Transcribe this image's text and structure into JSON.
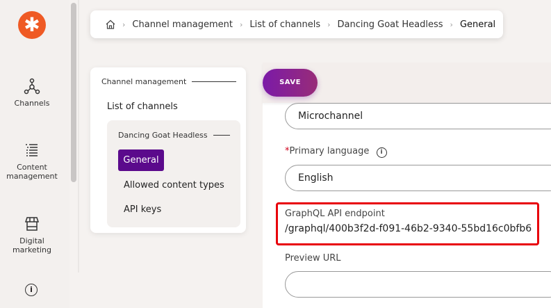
{
  "sidebar": {
    "items": [
      {
        "label": "Channels",
        "icon": "channels-icon"
      },
      {
        "label": "Content management",
        "icon": "content-list-icon"
      },
      {
        "label": "Digital marketing",
        "icon": "store-icon"
      }
    ],
    "logo": "xperience-logo",
    "info_icon": "info-icon"
  },
  "breadcrumb": {
    "items": [
      "Channel management",
      "List of channels",
      "Dancing Goat Headless",
      "General"
    ]
  },
  "leftnav": {
    "section": "Channel management",
    "list_link": "List of channels",
    "group": "Dancing Goat Headless",
    "items": [
      "General",
      "Allowed content types",
      "API keys"
    ],
    "selected": "General"
  },
  "toolbar": {
    "save_label": "SAVE"
  },
  "form": {
    "channel_type_value": "Microchannel",
    "primary_language_label": "Primary language",
    "required_marker": "*",
    "primary_language_value": "English",
    "graphql_label": "GraphQL API endpoint",
    "graphql_value": "/graphql/400b3f2d-f091-46b2-9340-55bd16c0bfb6",
    "preview_label": "Preview URL",
    "preview_value": ""
  },
  "colors": {
    "accent": "#5b0a8c",
    "logo": "#ef5a24",
    "highlight": "#e8000b"
  }
}
